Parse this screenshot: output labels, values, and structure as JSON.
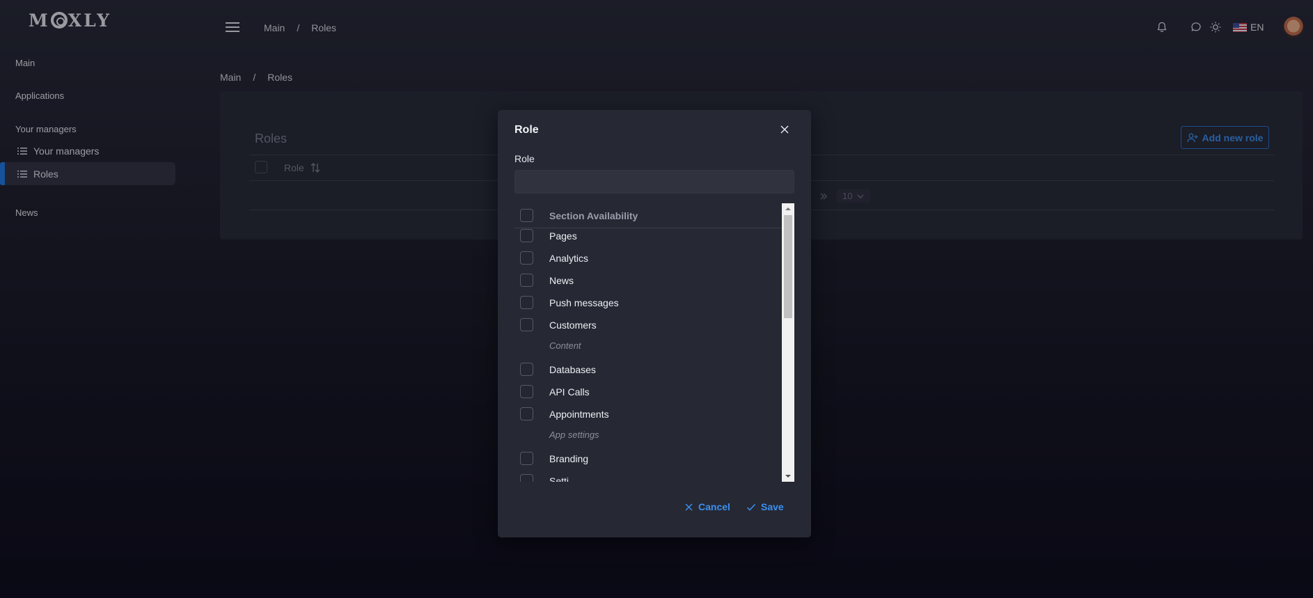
{
  "brand": {
    "logo_text_left": "M",
    "logo_text_right": "XLY"
  },
  "sidebar": {
    "sections": [
      {
        "label": "Main"
      },
      {
        "label": "Applications"
      },
      {
        "label": "Your managers"
      },
      {
        "label": "News"
      }
    ],
    "items": [
      {
        "label": "Your managers",
        "icon": "list-icon",
        "active": false
      },
      {
        "label": "Roles",
        "icon": "list-icon",
        "active": true
      }
    ]
  },
  "topbar": {
    "breadcrumb": [
      "Main",
      "Roles"
    ],
    "breadcrumb_sep": "/",
    "language": "EN"
  },
  "page": {
    "breadcrumb": [
      "Main",
      "Roles"
    ],
    "breadcrumb_sep": "/",
    "card_title": "Roles",
    "add_button": "Add new role",
    "table_header": {
      "role": "Role"
    },
    "pager_size": "10"
  },
  "modal": {
    "title": "Role",
    "field_label": "Role",
    "field_value": "",
    "field_placeholder": "",
    "list_header": "Section Availability",
    "rows": [
      {
        "type": "item",
        "label": "Pages"
      },
      {
        "type": "item",
        "label": "Analytics"
      },
      {
        "type": "item",
        "label": "News"
      },
      {
        "type": "item",
        "label": "Push messages"
      },
      {
        "type": "item",
        "label": "Customers"
      },
      {
        "type": "group",
        "label": "Content"
      },
      {
        "type": "item",
        "label": "Databases"
      },
      {
        "type": "item",
        "label": "API Calls"
      },
      {
        "type": "item",
        "label": "Appointments"
      },
      {
        "type": "group",
        "label": "App settings"
      },
      {
        "type": "item",
        "label": "Branding"
      },
      {
        "type": "item",
        "label": "Setti"
      }
    ],
    "cancel_label": "Cancel",
    "save_label": "Save"
  },
  "colors": {
    "accent": "#1e78e6",
    "link": "#3b8ff0"
  }
}
